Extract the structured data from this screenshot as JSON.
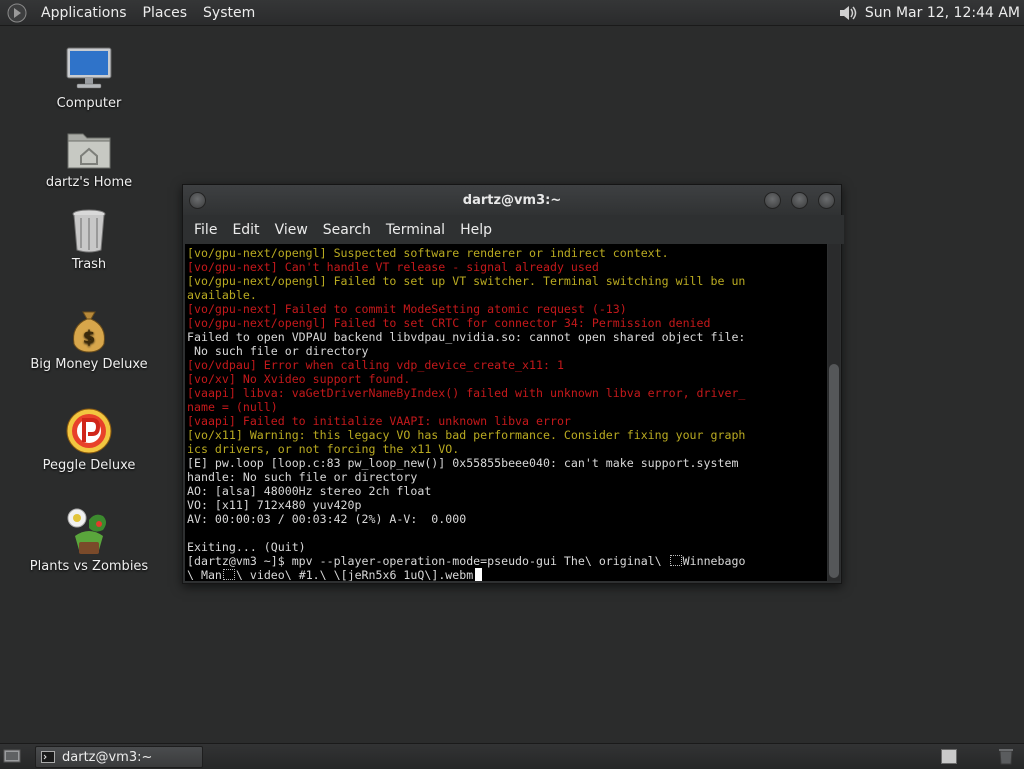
{
  "top_panel": {
    "menus": [
      "Applications",
      "Places",
      "System"
    ],
    "clock": "Sun Mar 12, 12:44 AM",
    "icons": {
      "logo": "gnome-foot-icon",
      "volume": "speaker-volume-icon"
    }
  },
  "desktop_icons": [
    {
      "label": "Computer",
      "icon": "computer-monitor-icon"
    },
    {
      "label": "dartz's Home",
      "icon": "home-folder-icon"
    },
    {
      "label": "Trash",
      "icon": "trash-can-icon"
    },
    {
      "label": "Big Money Deluxe",
      "icon": "money-bag-icon"
    },
    {
      "label": "Peggle Deluxe",
      "icon": "peggle-icon"
    },
    {
      "label": "Plants vs Zombies",
      "icon": "plants-vs-zombies-icon"
    }
  ],
  "terminal": {
    "title": "dartz@vm3:~",
    "menus": [
      "File",
      "Edit",
      "View",
      "Search",
      "Terminal",
      "Help"
    ],
    "lines": [
      {
        "text": "[vo/gpu-next/opengl] Suspected software renderer or indirect context.",
        "color": "yellow"
      },
      {
        "text": "[vo/gpu-next] Can't handle VT release - signal already used",
        "color": "red"
      },
      {
        "text": "[vo/gpu-next/opengl] Failed to set up VT switcher. Terminal switching will be un",
        "color": "yellow"
      },
      {
        "text": "available.",
        "color": "yellow"
      },
      {
        "text": "[vo/gpu-next] Failed to commit ModeSetting atomic request (-13)",
        "color": "red"
      },
      {
        "text": "[vo/gpu-next/opengl] Failed to set CRTC for connector 34: Permission denied",
        "color": "red"
      },
      {
        "text": "Failed to open VDPAU backend libvdpau_nvidia.so: cannot open shared object file:",
        "color": "white"
      },
      {
        "text": " No such file or directory",
        "color": "white"
      },
      {
        "text": "[vo/vdpau] Error when calling vdp_device_create_x11: 1",
        "color": "red"
      },
      {
        "text": "[vo/xv] No Xvideo support found.",
        "color": "red"
      },
      {
        "text": "[vaapi] libva: vaGetDriverNameByIndex() failed with unknown libva error, driver_",
        "color": "red"
      },
      {
        "text": "name = (null)",
        "color": "red"
      },
      {
        "text": "[vaapi] Failed to initialize VAAPI: unknown libva error",
        "color": "red"
      },
      {
        "text": "[vo/x11] Warning: this legacy VO has bad performance. Consider fixing your graph",
        "color": "yellow"
      },
      {
        "text": "ics drivers, or not forcing the x11 VO.",
        "color": "yellow"
      },
      {
        "text": "[E] pw.loop [loop.c:83 pw_loop_new()] 0x55855beee040: can't make support.system",
        "color": "white"
      },
      {
        "text": "handle: No such file or directory",
        "color": "white"
      },
      {
        "text": "AO: [alsa] 48000Hz stereo 2ch float",
        "color": "white"
      },
      {
        "text": "VO: [x11] 712x480 yuv420p",
        "color": "white"
      },
      {
        "text": "AV: 00:00:03 / 00:03:42 (2%) A-V:  0.000",
        "color": "white"
      },
      {
        "text": "",
        "color": "white"
      },
      {
        "text": "Exiting... (Quit)",
        "color": "white"
      }
    ],
    "prompt": {
      "line1_a": "[dartz@vm3 ~]$ mpv --player-operation-mode=pseudo-gui The\\ original\\ ",
      "line1_b": "Winnebago",
      "line2_a": "\\ Man",
      "line2_b": "\\ video\\ #1.\\ \\[jeRn5x6_1uQ\\].webm"
    }
  },
  "bottom_panel": {
    "task_label": "dartz@vm3:~",
    "icons": {
      "show_desktop": "show-desktop-icon",
      "task": "terminal-icon",
      "workspace": "workspace-switcher-icon",
      "trash": "trash-applet-icon"
    }
  },
  "colors": {
    "terminal_bg": "#000000",
    "text_white": "#d8d8d8",
    "text_red": "#c4191b",
    "text_yellow": "#b9aa21",
    "desktop_bg": "#2b2c2c"
  }
}
